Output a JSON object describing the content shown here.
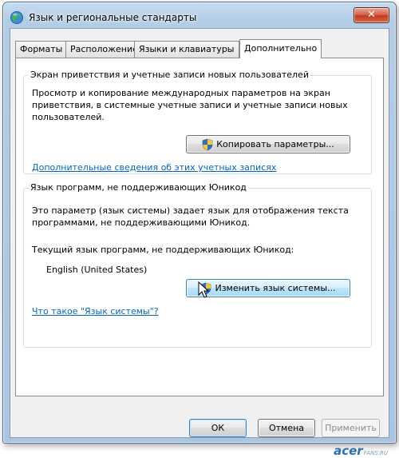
{
  "window": {
    "title": "Язык и региональные стандарты",
    "close_glyph": "✕"
  },
  "tabs": [
    {
      "label": "Форматы"
    },
    {
      "label": "Расположение"
    },
    {
      "label": "Языки и клавиатуры"
    },
    {
      "label": "Дополнительно",
      "active": true
    }
  ],
  "welcome_group": {
    "title": "Экран приветствия и учетные записи новых пользователей",
    "description_line1": "Просмотр и копирование международных параметров на экран",
    "description_line2": "приветствия, в системные учетные записи и учетные записи новых",
    "description_line3": "пользователей.",
    "copy_button": "Копировать параметры...",
    "more_link": "Дополнительные сведения об этих учетных записях"
  },
  "nonunicode_group": {
    "title": "Язык программ, не поддерживающих Юникод",
    "description_line1": "Это параметр (язык системы) задает язык для отображения текста",
    "description_line2": "программами, не поддерживающими Юникод.",
    "current_label": "Текущий язык программ, не поддерживающих Юникод:",
    "current_value": "English (United States)",
    "change_button": "Изменить язык системы...",
    "what_link": "Что такое \"Язык системы\"?"
  },
  "footer": {
    "ok": "ОК",
    "cancel": "Отмена",
    "apply": "Применить"
  },
  "watermark": {
    "brand": "acer",
    "suffix": "FANS.RU"
  },
  "colors": {
    "link": "#0066cc",
    "accent": "#3c7fb1",
    "close": "#c3381c"
  }
}
